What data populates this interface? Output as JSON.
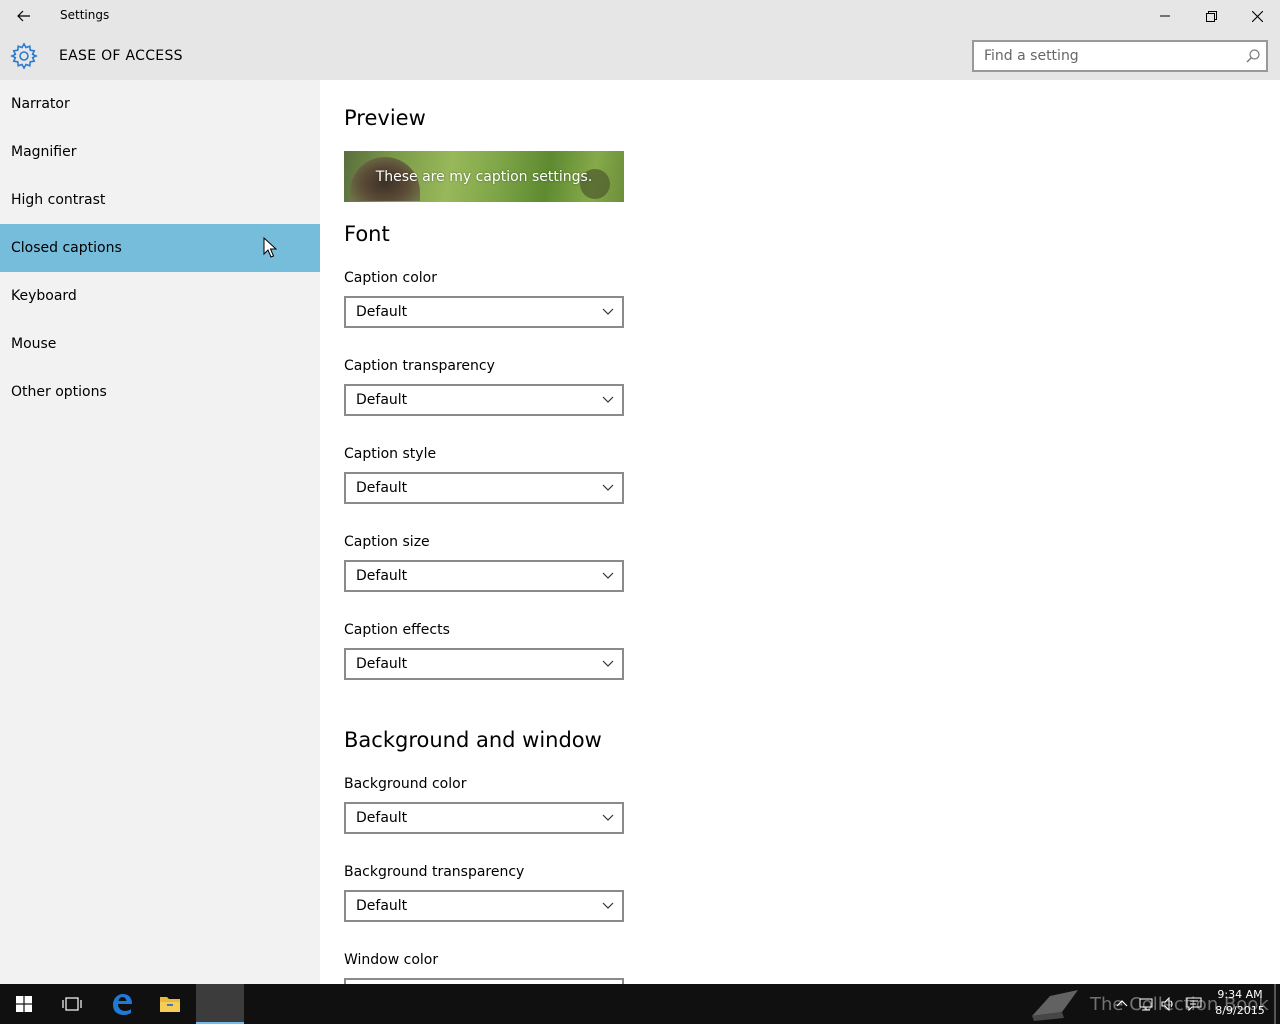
{
  "window": {
    "title": "Settings"
  },
  "header": {
    "section_title": "EASE OF ACCESS",
    "search_placeholder": "Find a setting"
  },
  "sidebar": {
    "items": [
      {
        "label": "Narrator"
      },
      {
        "label": "Magnifier"
      },
      {
        "label": "High contrast"
      },
      {
        "label": "Closed captions",
        "active": true
      },
      {
        "label": "Keyboard"
      },
      {
        "label": "Mouse"
      },
      {
        "label": "Other options"
      }
    ]
  },
  "main": {
    "preview_heading": "Preview",
    "preview_caption": "These are my caption settings.",
    "font_heading": "Font",
    "font_fields": [
      {
        "label": "Caption color",
        "value": "Default"
      },
      {
        "label": "Caption transparency",
        "value": "Default"
      },
      {
        "label": "Caption style",
        "value": "Default"
      },
      {
        "label": "Caption size",
        "value": "Default"
      },
      {
        "label": "Caption effects",
        "value": "Default"
      }
    ],
    "background_heading": "Background and window",
    "background_fields": [
      {
        "label": "Background color",
        "value": "Default"
      },
      {
        "label": "Background transparency",
        "value": "Default"
      },
      {
        "label": "Window color",
        "value": ""
      }
    ]
  },
  "taskbar": {
    "watermark": "The Collection Book",
    "time": "9:34 AM",
    "date": "8/9/2015"
  },
  "colors": {
    "accent_active": "#76bcdb",
    "titlebar": "#e6e6e6",
    "sidebar": "#f2f2f2",
    "taskbar": "#101010",
    "gear": "#2b7bd0"
  },
  "icons": [
    "back-arrow-icon",
    "minimize-icon",
    "maximize-icon",
    "close-icon",
    "gear-icon",
    "search-icon",
    "chevron-down-icon",
    "windows-start-icon",
    "task-view-icon",
    "edge-icon",
    "file-explorer-icon",
    "network-icon",
    "volume-icon",
    "action-center-icon"
  ]
}
